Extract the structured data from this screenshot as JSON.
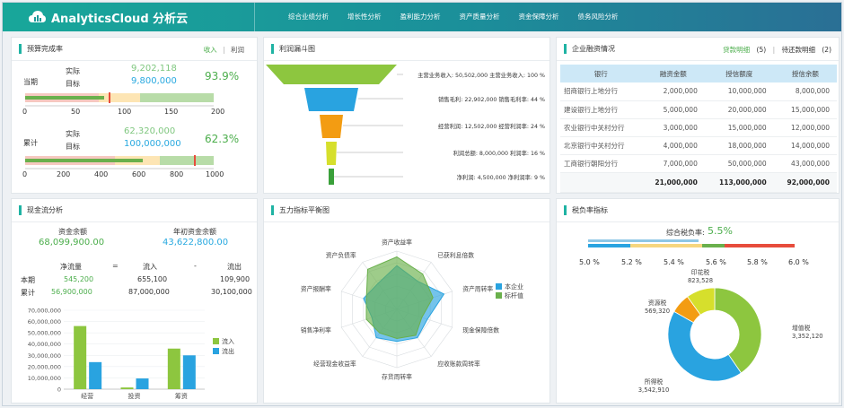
{
  "brand": {
    "name": "AnalyticsCloud 分析云"
  },
  "nav": [
    "综合业绩分析",
    "增长性分析",
    "盈利能力分析",
    "资产质量分析",
    "资金保障分析",
    "债务风险分析"
  ],
  "budget": {
    "title": "预算完成率",
    "tabs": [
      "收入",
      "利润"
    ],
    "tab_sep": "|",
    "current": {
      "label": "当期",
      "actual_label": "实际",
      "actual_value": "9,202,118",
      "target_label": "目标",
      "target_value": "9,800,000",
      "rate": "93.9%",
      "ticks": [
        "0",
        "50",
        "100",
        "150",
        "200"
      ]
    },
    "cumulative": {
      "label": "累计",
      "actual_label": "实际",
      "actual_value": "62,320,000",
      "target_label": "目标",
      "target_value": "100,000,000",
      "rate": "62.3%",
      "ticks": [
        "0",
        "200",
        "400",
        "600",
        "800",
        "1000"
      ]
    }
  },
  "funnel": {
    "title": "利润漏斗图",
    "levels": [
      {
        "label": "主营业务收入: 50,502,000 主营业务收入: 100 %",
        "color": "#8dc63f"
      },
      {
        "label": "销售毛利: 22,902,000 销售毛利率: 44 %",
        "color": "#29a3e0"
      },
      {
        "label": "经营利润: 12,502,000 经营利润率: 24 %",
        "color": "#f39c12"
      },
      {
        "label": "利润总额: 8,000,000 利润率: 16 %",
        "color": "#d6df2c"
      },
      {
        "label": "净利润: 4,500,000 净利润率: 9 %",
        "color": "#3aa03a"
      }
    ]
  },
  "loans": {
    "title": "企业融资情况",
    "tab_active": "贷款明细",
    "tab_active_count": "(5)",
    "tab_sep": "|",
    "tab_other": "待还款明细",
    "tab_other_count": "(2)",
    "headers": [
      "银行",
      "融资金额",
      "授信额度",
      "授信余额"
    ],
    "rows": [
      [
        "招商银行上地分行",
        "2,000,000",
        "10,000,000",
        "8,000,000"
      ],
      [
        "建设银行上地分行",
        "5,000,000",
        "20,000,000",
        "15,000,000"
      ],
      [
        "农业银行中关村分行",
        "3,000,000",
        "15,000,000",
        "12,000,000"
      ],
      [
        "北京银行中关村分行",
        "4,000,000",
        "18,000,000",
        "14,000,000"
      ],
      [
        "工商银行朝阳分行",
        "7,000,000",
        "50,000,000",
        "43,000,000"
      ]
    ],
    "totals": [
      "",
      "21,000,000",
      "113,000,000",
      "92,000,000"
    ]
  },
  "cashflow": {
    "title": "现金流分析",
    "balance_label": "资金余额",
    "balance_value": "68,099,900.00",
    "year_label": "年初资金余额",
    "year_value": "43,622,800.00",
    "headers": [
      "净流量",
      "=",
      "流入",
      "-",
      "流出"
    ],
    "rows": [
      {
        "label": "本期",
        "net": "545,200",
        "in": "655,100",
        "out": "109,900"
      },
      {
        "label": "累计",
        "net": "56,900,000",
        "in": "87,000,000",
        "out": "30,100,000"
      }
    ],
    "chart_data": {
      "type": "bar",
      "categories": [
        "经营",
        "投资",
        "筹资"
      ],
      "series": [
        {
          "name": "流入",
          "color": "#8dc63f",
          "values": [
            56000000,
            1500000,
            36000000
          ]
        },
        {
          "name": "流出",
          "color": "#29a3e0",
          "values": [
            24000000,
            9500000,
            30000000
          ]
        }
      ],
      "ylim": [
        0,
        70000000
      ],
      "y_ticks": [
        "0",
        "10,000,000",
        "20,000,000",
        "30,000,000",
        "40,000,000",
        "50,000,000",
        "60,000,000",
        "70,000,000"
      ]
    }
  },
  "radar": {
    "title": "五力指标平衡图",
    "chart_data": {
      "type": "radar",
      "axes": [
        "资产收益率",
        "已获利息倍数",
        "资产周转率",
        "现金保障倍数",
        "应收账款周转率",
        "存货周转率",
        "经营现金收益率",
        "销售净利率",
        "资产报酬率",
        "资产负债率"
      ],
      "series": [
        {
          "name": "本企业",
          "color": "#29a3e0",
          "values": [
            0.75,
            0.6,
            0.85,
            0.55,
            0.6,
            0.55,
            0.6,
            0.45,
            0.6,
            0.55
          ]
        },
        {
          "name": "标杆值",
          "color": "#6ab04c",
          "values": [
            0.9,
            0.75,
            0.65,
            0.45,
            0.55,
            0.5,
            0.5,
            0.55,
            0.55,
            0.85
          ]
        }
      ],
      "range": [
        0,
        1
      ]
    }
  },
  "tax": {
    "title": "税负率指标",
    "overall_label": "综合税负率:",
    "overall_value": "5.5%",
    "scale": [
      "5.0 %",
      "5.2 %",
      "5.4 %",
      "5.6 %",
      "5.8 %",
      "6.0 %"
    ],
    "chart_data": {
      "type": "pie",
      "donut": true,
      "slices": [
        {
          "name": "增值税",
          "value": 3352120,
          "label": "3,352,120",
          "color": "#8dc63f"
        },
        {
          "name": "所得税",
          "value": 3542910,
          "label": "3,542,910",
          "color": "#29a3e0"
        },
        {
          "name": "资源税",
          "value": 569320,
          "label": "569,320",
          "color": "#f39c12"
        },
        {
          "name": "印花税",
          "value": 823528,
          "label": "823,528",
          "color": "#d6df2c"
        }
      ]
    }
  },
  "colors": {
    "accent": "#1fb3a3",
    "green": "#8dc63f",
    "blue": "#29a3e0",
    "orange": "#f39c12",
    "red": "#e74c3c"
  }
}
